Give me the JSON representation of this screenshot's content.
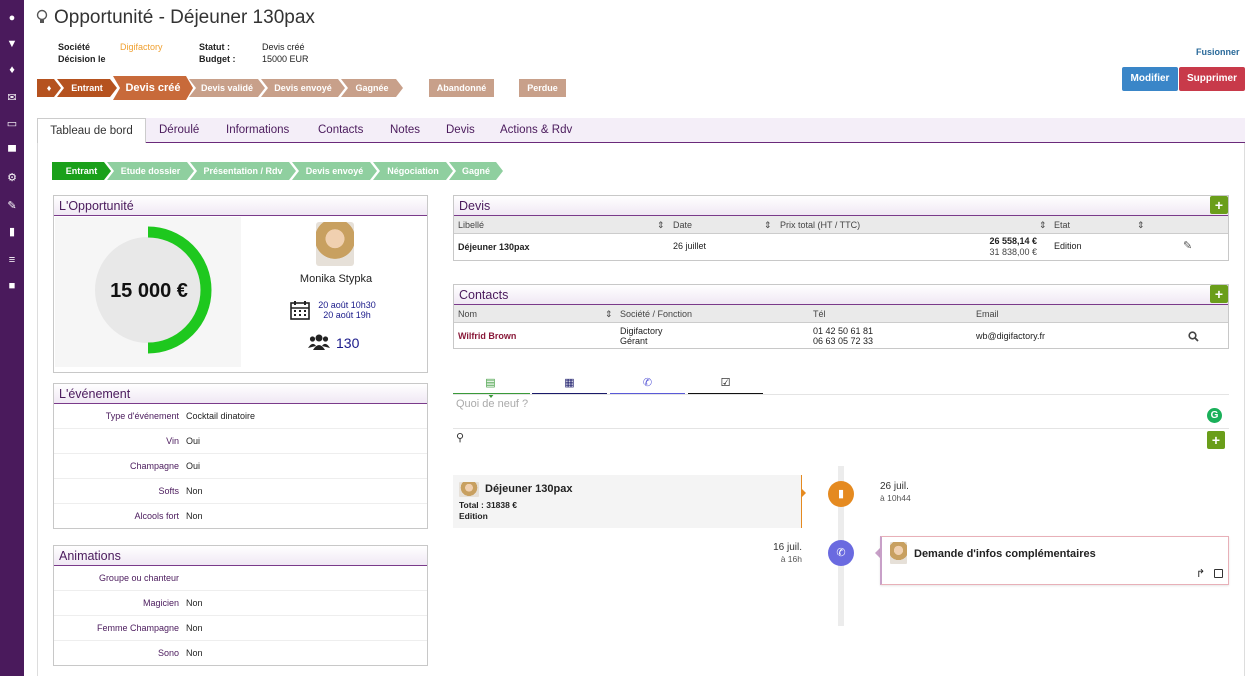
{
  "title": "Opportunité - Déjeuner 130pax",
  "meta": {
    "societe_label": "Société",
    "societe_value": "Digifactory",
    "decision_label": "Décision le",
    "statut_label": "Statut :",
    "statut_value": "Devis créé",
    "budget_label": "Budget :",
    "budget_value": "15000 EUR"
  },
  "fusionner": "Fusionner",
  "buttons": {
    "modifier": "Modifier",
    "supprimer": "Supprimer"
  },
  "stages": [
    "Entrant",
    "Devis créé",
    "Devis validé",
    "Devis envoyé",
    "Gagnée"
  ],
  "status_buttons": [
    "Abandonné",
    "Perdue"
  ],
  "tabs": [
    "Tableau de bord",
    "Déroulé",
    "Informations",
    "Contacts",
    "Notes",
    "Devis",
    "Actions & Rdv"
  ],
  "process_steps": [
    "Entrant",
    "Etude dossier",
    "Présentation / Rdv",
    "Devis envoyé",
    "Négociation",
    "Gagné"
  ],
  "opportunite": {
    "title": "L'Opportunité",
    "amount": "15 000 €",
    "progress": 0.5,
    "person": "Monika Stypka",
    "date1": "20 août 10h30",
    "date2": "20 août 19h",
    "guests": "130"
  },
  "evenement": {
    "title": "L'événement",
    "rows": [
      {
        "label": "Type d'événement",
        "value": "Cocktail dinatoire"
      },
      {
        "label": "Vin",
        "value": "Oui"
      },
      {
        "label": "Champagne",
        "value": "Oui"
      },
      {
        "label": "Softs",
        "value": "Non"
      },
      {
        "label": "Alcools fort",
        "value": "Non"
      }
    ]
  },
  "animations": {
    "title": "Animations",
    "rows": [
      {
        "label": "Groupe ou chanteur",
        "value": ""
      },
      {
        "label": "Magicien",
        "value": "Non"
      },
      {
        "label": "Femme Champagne",
        "value": "Non"
      },
      {
        "label": "Sono",
        "value": "Non"
      }
    ]
  },
  "devis": {
    "title": "Devis",
    "headers": [
      "Libellé",
      "Date",
      "Prix total (HT / TTC)",
      "Etat"
    ],
    "row": {
      "libelle": "Déjeuner 130pax",
      "date": "26 juillet",
      "ht": "26 558,14 €",
      "ttc": "31 838,00 €",
      "etat": "Edition"
    }
  },
  "contacts": {
    "title": "Contacts",
    "headers": [
      "Nom",
      "Société / Fonction",
      "Tél",
      "Email"
    ],
    "row": {
      "nom": "Wilfrid Brown",
      "societe": "Digifactory",
      "fonction": "Gérant",
      "tel1": "01 42 50 61 81",
      "tel2": "06 63 05 72 33",
      "email": "wb@digifactory.fr"
    }
  },
  "feed": {
    "placeholder": "Quoi de neuf ?"
  },
  "timeline": [
    {
      "title": "Déjeuner 130pax",
      "line1": "Total : 31838 €",
      "line2": "Edition",
      "date": "26 juil.",
      "time": "à 10h44"
    },
    {
      "title": "Demande d'infos complémentaires",
      "date": "16 juil.",
      "time": "à 16h"
    }
  ],
  "colors": {
    "purple": "#4a1a5c",
    "entrant": "#b5521f",
    "devis_cree": "#c86a3a",
    "stage_light": "#c8a08a",
    "green_dark": "#1aa01a",
    "green_light": "#8fcf9f",
    "modifier": "#3a86c8",
    "supprimer": "#c83a4a"
  }
}
